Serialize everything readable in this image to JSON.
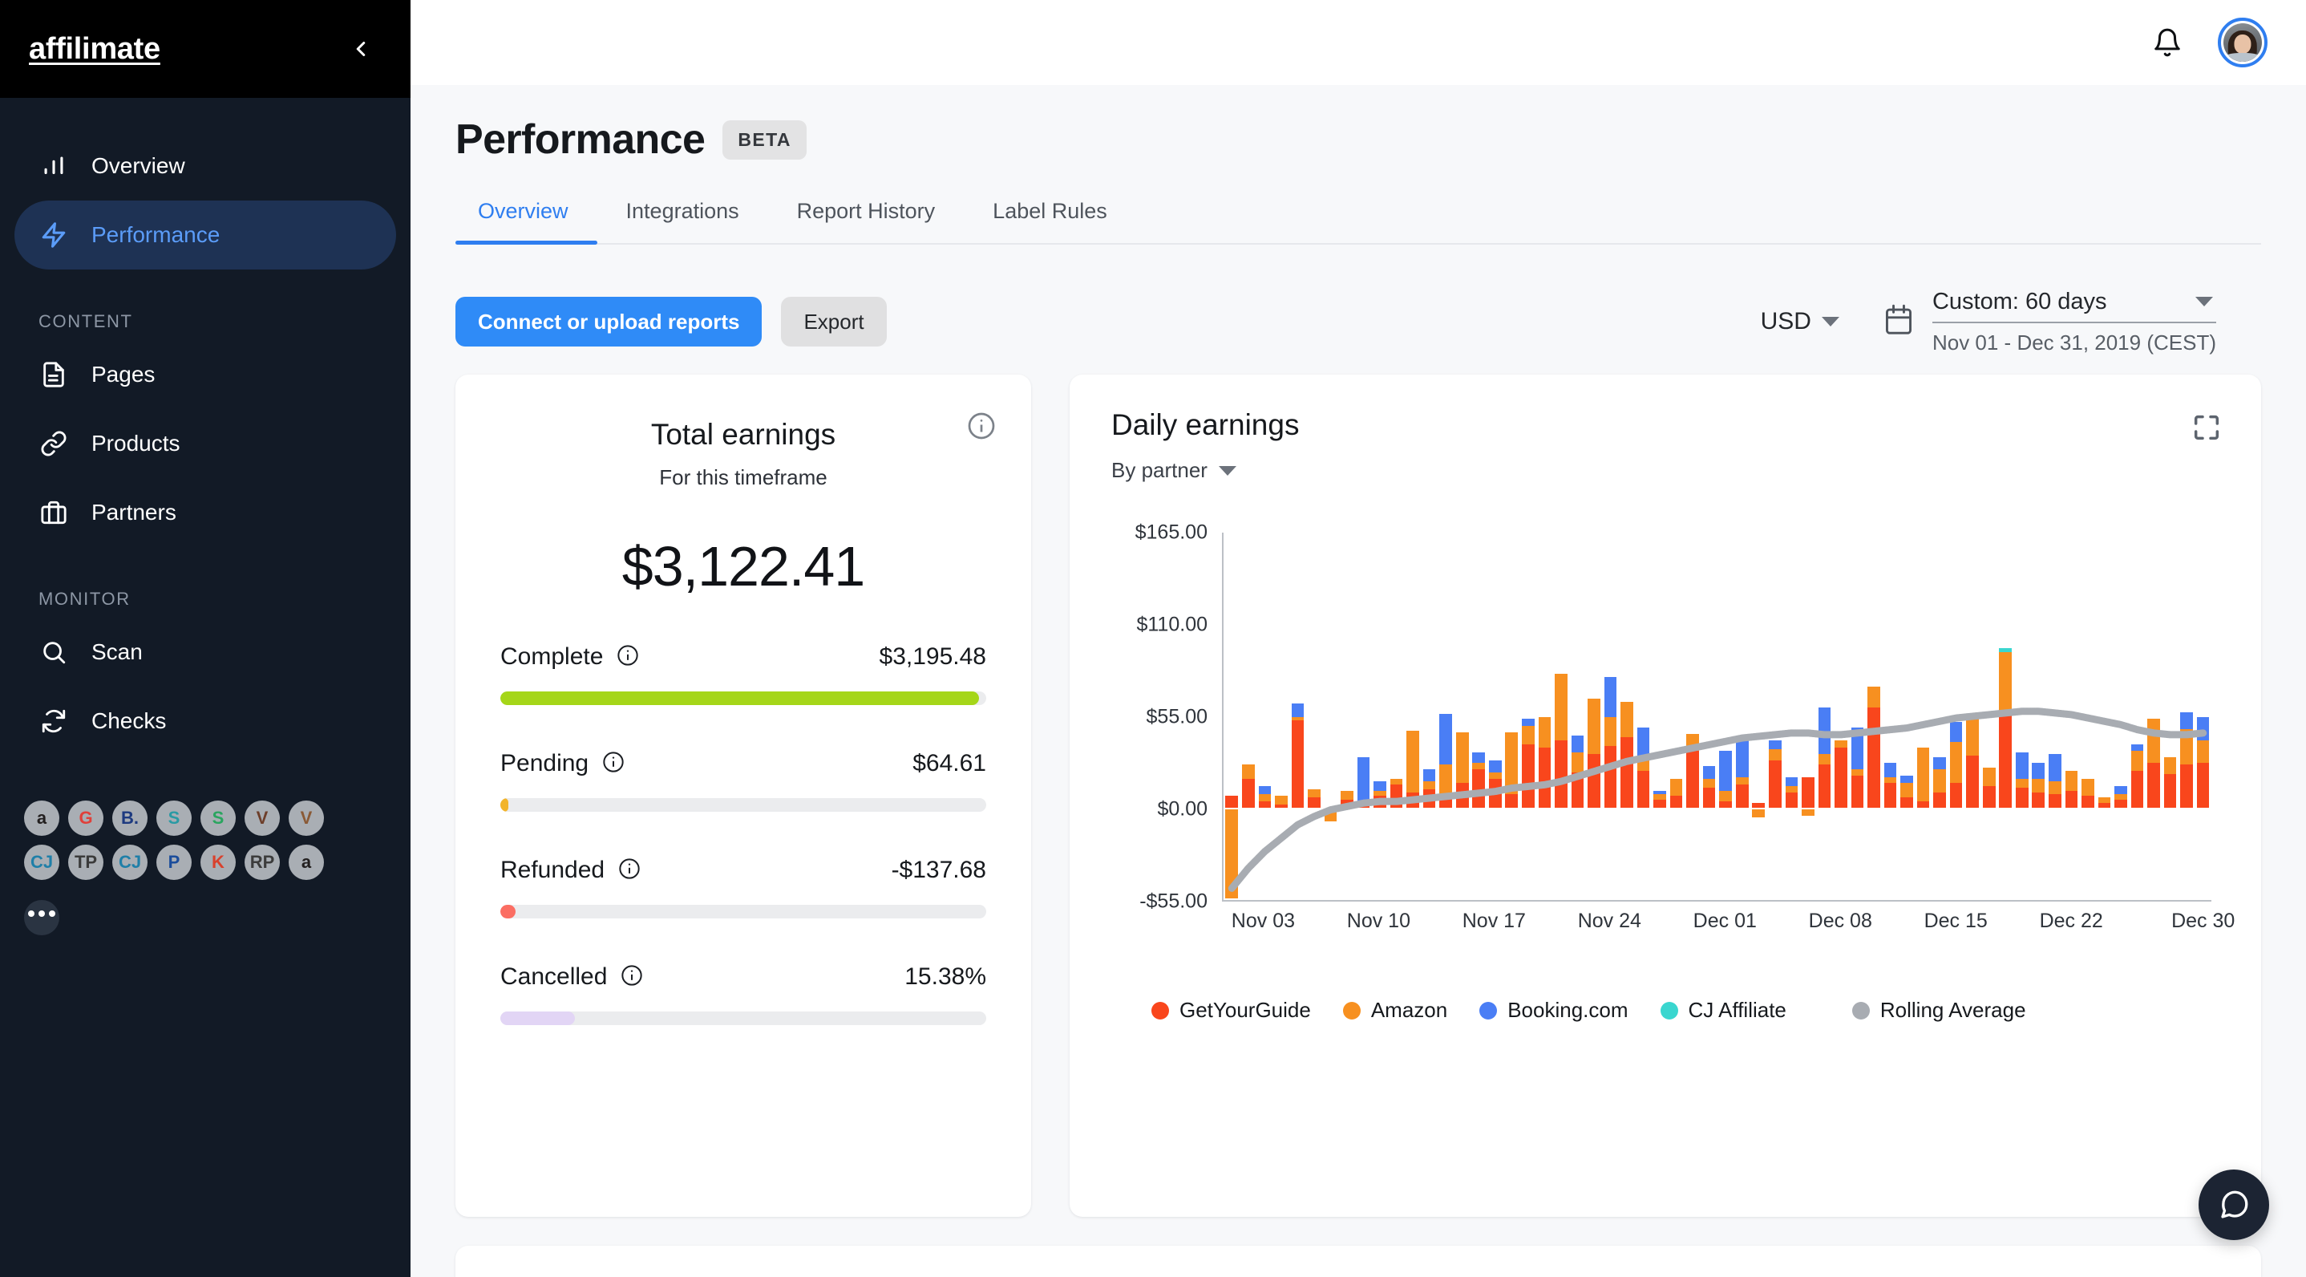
{
  "sidebar": {
    "brand": "affilimate",
    "collapse_icon": "chevron-left-icon",
    "nav": [
      {
        "label": "Overview",
        "icon": "bar-chart-icon",
        "active": false
      },
      {
        "label": "Performance",
        "icon": "lightning-bolt-icon",
        "active": true
      }
    ],
    "groups": [
      {
        "title": "CONTENT",
        "items": [
          {
            "label": "Pages",
            "icon": "document-icon"
          },
          {
            "label": "Products",
            "icon": "link-icon"
          },
          {
            "label": "Partners",
            "icon": "briefcase-icon"
          }
        ]
      },
      {
        "title": "MONITOR",
        "items": [
          {
            "label": "Scan",
            "icon": "search-icon"
          },
          {
            "label": "Checks",
            "icon": "refresh-icon"
          }
        ]
      }
    ],
    "partner_chips": [
      {
        "name": "amazon",
        "glyph": "a",
        "color": "#221f1f"
      },
      {
        "name": "getyourguide",
        "glyph": "G",
        "color": "#e0403a"
      },
      {
        "name": "booking-com",
        "glyph": "B.",
        "color": "#1d3a80"
      },
      {
        "name": "skyscanner",
        "glyph": "S",
        "color": "#2a9aa4"
      },
      {
        "name": "skimlinks",
        "glyph": "S",
        "color": "#2aa55f"
      },
      {
        "name": "viator-pin",
        "glyph": "V",
        "color": "#6d3e2a"
      },
      {
        "name": "viator",
        "glyph": "V",
        "color": "#8a5a36"
      },
      {
        "name": "cj-affiliate",
        "glyph": "CJ",
        "color": "#1f7fa8"
      },
      {
        "name": "travelpayouts",
        "glyph": "TP",
        "color": "#3b3b3b"
      },
      {
        "name": "cj-affiliate-2",
        "glyph": "CJ",
        "color": "#1f7fa8"
      },
      {
        "name": "partnerize",
        "glyph": "P",
        "color": "#1b4d9b"
      },
      {
        "name": "klook",
        "glyph": "K",
        "color": "#d9412c"
      },
      {
        "name": "rakuten",
        "glyph": "RP",
        "color": "#3c3c3c"
      },
      {
        "name": "amazon-2",
        "glyph": "a",
        "color": "#221f1f"
      }
    ],
    "more_label": "more-partners"
  },
  "topbar": {
    "bell_icon": "bell-icon",
    "avatar_icon": "user-avatar"
  },
  "header": {
    "title": "Performance",
    "badge": "BETA",
    "tabs": [
      {
        "label": "Overview",
        "active": true
      },
      {
        "label": "Integrations",
        "active": false
      },
      {
        "label": "Report History",
        "active": false
      },
      {
        "label": "Label Rules",
        "active": false
      }
    ]
  },
  "toolbar": {
    "primary_label": "Connect or upload reports",
    "secondary_label": "Export",
    "currency": "USD",
    "calendar_icon": "calendar-icon",
    "date_preset": "Custom: 60 days",
    "date_range": "Nov 01 - Dec 31, 2019 (CEST)"
  },
  "earnings": {
    "title": "Total earnings",
    "subtitle": "For this timeframe",
    "amount": "$3,122.41",
    "info_icon": "info-icon",
    "metrics": [
      {
        "label": "Complete",
        "value": "$3,195.48",
        "pct": 98.5,
        "color": "#a5d619"
      },
      {
        "label": "Pending",
        "value": "$64.61",
        "pct": 1.6,
        "color": "#f2b42b"
      },
      {
        "label": "Refunded",
        "value": "-$137.68",
        "pct": 3.2,
        "color": "#fb6e63"
      },
      {
        "label": "Cancelled",
        "value": "15.38%",
        "pct": 15.38,
        "color": "#e2d5f5"
      }
    ]
  },
  "chart_card": {
    "title": "Daily earnings",
    "group_by": "By partner",
    "expand_icon": "expand-icon"
  },
  "chart_data": {
    "type": "bar",
    "title": "Daily earnings",
    "subtitle": "By partner",
    "stacked": true,
    "xlabel": "",
    "ylabel": "",
    "ylim": [
      -55,
      165
    ],
    "yticks": [
      165,
      110,
      55,
      0,
      -55
    ],
    "ytick_labels": [
      "$165.00",
      "$110.00",
      "$55.00",
      "$0.00",
      "-$55.00"
    ],
    "xtick_labels": [
      "Nov 03",
      "Nov 10",
      "Nov 17",
      "Nov 24",
      "Dec 01",
      "Dec 08",
      "Dec 15",
      "Dec 22",
      "Dec 30"
    ],
    "xtick_indices": [
      2,
      9,
      16,
      23,
      30,
      37,
      44,
      51,
      59
    ],
    "grid": false,
    "legend_position": "bottom",
    "legend": [
      {
        "name": "GetYourGuide",
        "color": "#f9461c"
      },
      {
        "name": "Amazon",
        "color": "#f79020"
      },
      {
        "name": "Booking.com",
        "color": "#4a7ef5"
      },
      {
        "name": "CJ Affiliate",
        "color": "#3ad6cf"
      },
      {
        "name": "Rolling Average",
        "color": "#a8acb2"
      }
    ],
    "series": [
      {
        "name": "GetYourGuide",
        "color": "#f9461c",
        "values": [
          7,
          17,
          4,
          2,
          52,
          6,
          0,
          5,
          2,
          7,
          14,
          9,
          11,
          6,
          15,
          23,
          17,
          8,
          38,
          36,
          40,
          21,
          32,
          37,
          42,
          22,
          5,
          7,
          34,
          12,
          4,
          14,
          3,
          28,
          9,
          18,
          26,
          36,
          19,
          60,
          15,
          6,
          4,
          9,
          15,
          31,
          13,
          55,
          12,
          9,
          8,
          10,
          7,
          3,
          5,
          22,
          27,
          20,
          26,
          27
        ]
      },
      {
        "name": "Amazon",
        "color": "#f79020",
        "values": [
          -53,
          9,
          4,
          5,
          2,
          5,
          -7,
          5,
          2,
          3,
          3,
          37,
          5,
          20,
          30,
          4,
          4,
          37,
          11,
          18,
          40,
          12,
          33,
          17,
          21,
          9,
          3,
          10,
          10,
          5,
          6,
          4,
          -5,
          7,
          4,
          -4,
          6,
          4,
          4,
          12,
          3,
          9,
          32,
          14,
          24,
          25,
          11,
          38,
          5,
          8,
          8,
          12,
          10,
          3,
          3,
          12,
          26,
          10,
          21,
          13
        ]
      },
      {
        "name": "Booking.com",
        "color": "#4a7ef5",
        "values": [
          0,
          0,
          5,
          0,
          8,
          0,
          0,
          0,
          26,
          6,
          0,
          0,
          7,
          30,
          0,
          6,
          7,
          0,
          4,
          0,
          0,
          10,
          0,
          24,
          0,
          17,
          2,
          0,
          0,
          8,
          24,
          23,
          0,
          5,
          5,
          0,
          28,
          0,
          25,
          0,
          9,
          4,
          0,
          7,
          12,
          0,
          0,
          0,
          16,
          10,
          16,
          0,
          0,
          0,
          5,
          4,
          0,
          0,
          10,
          14
        ]
      },
      {
        "name": "CJ Affiliate",
        "color": "#3ad6cf",
        "values": [
          0,
          0,
          0,
          0,
          0,
          0,
          0,
          0,
          0,
          0,
          0,
          0,
          0,
          0,
          0,
          0,
          0,
          0,
          0,
          0,
          0,
          0,
          0,
          0,
          0,
          0,
          0,
          0,
          0,
          0,
          0,
          0,
          0,
          0,
          0,
          0,
          0,
          0,
          0,
          0,
          0,
          0,
          0,
          0,
          0,
          0,
          0,
          2,
          0,
          0,
          0,
          0,
          0,
          0,
          0,
          0,
          0,
          0,
          0,
          0
        ]
      }
    ],
    "rolling_average": {
      "name": "Rolling Average",
      "color": "#a8acb2",
      "style": "dotted",
      "values": [
        -48,
        -36,
        -26,
        -18,
        -10,
        -5,
        -1,
        1,
        3,
        4,
        4,
        5,
        6,
        7,
        8,
        9,
        10,
        12,
        13,
        14,
        16,
        19,
        22,
        25,
        28,
        30,
        32,
        34,
        36,
        38,
        40,
        42,
        43,
        44,
        45,
        45,
        44,
        44,
        45,
        46,
        47,
        48,
        50,
        52,
        54,
        55,
        56,
        57,
        58,
        58,
        57,
        56,
        54,
        52,
        50,
        47,
        45,
        44,
        44,
        45
      ]
    }
  },
  "fab": {
    "icon": "chat-bubble-icon"
  }
}
